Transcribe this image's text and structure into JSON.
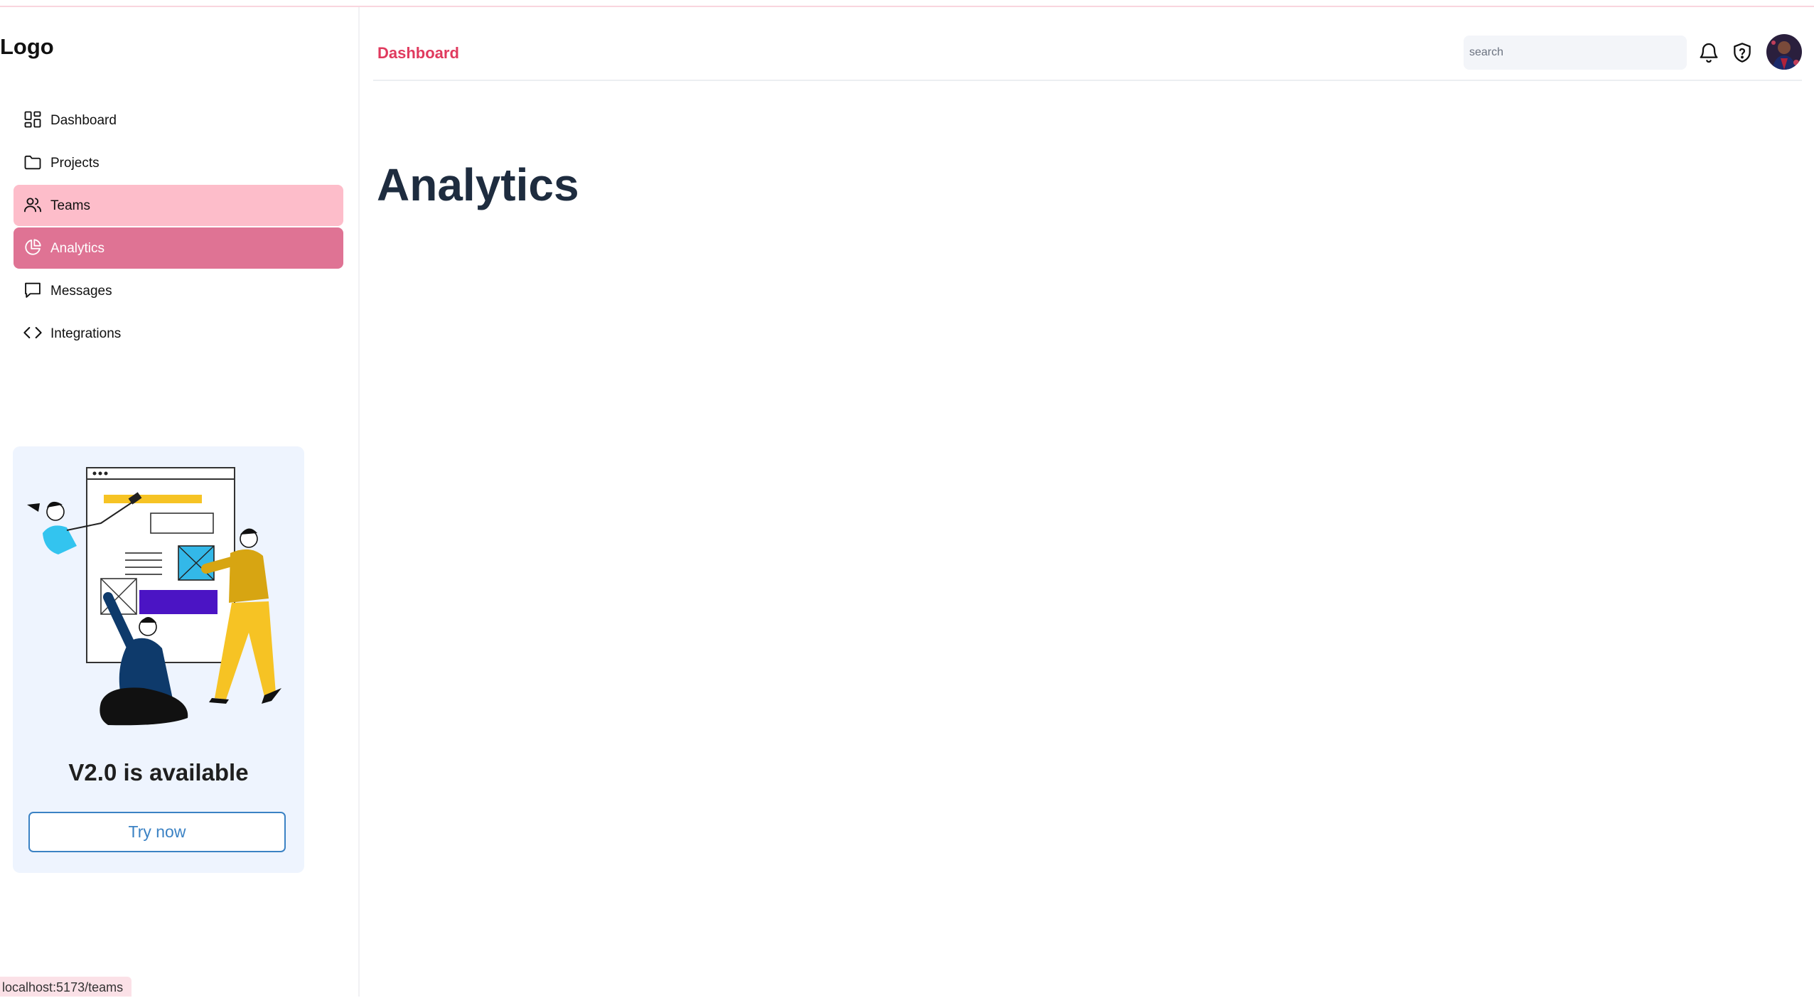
{
  "sidebar": {
    "logo": "Logo",
    "items": [
      {
        "label": "Dashboard",
        "icon": "dashboard-grid-icon"
      },
      {
        "label": "Projects",
        "icon": "folder-icon"
      },
      {
        "label": "Teams",
        "icon": "users-icon",
        "state": "hover"
      },
      {
        "label": "Analytics",
        "icon": "pie-chart-icon",
        "state": "active"
      },
      {
        "label": "Messages",
        "icon": "message-icon"
      },
      {
        "label": "Integrations",
        "icon": "code-icon"
      }
    ],
    "promo": {
      "title": "V2.0 is available",
      "button": "Try now"
    }
  },
  "header": {
    "breadcrumb": "Dashboard",
    "search_placeholder": "search",
    "icons": [
      "bell-icon",
      "shield-question-icon",
      "avatar"
    ]
  },
  "main": {
    "title": "Analytics"
  },
  "status_bar": {
    "url": "localhost:5173/teams"
  },
  "colors": {
    "accent": "#e03a5e",
    "nav_hover": "#fdbdca",
    "nav_active": "#df7394",
    "promo_bg": "#eef4fe",
    "title": "#1e2c3f"
  }
}
